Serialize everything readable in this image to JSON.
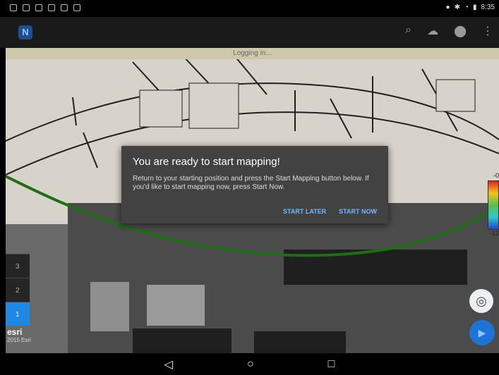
{
  "status_bar": {
    "time": "8:35"
  },
  "app_bar": {
    "logo_label": "N",
    "actions": [
      {
        "name": "search-icon"
      },
      {
        "name": "cloud-upload-icon"
      },
      {
        "name": "location-pin-icon"
      },
      {
        "name": "more-vert-icon"
      }
    ]
  },
  "map": {
    "status_text": "Logging in...",
    "layer_tabs": [
      "3",
      "2",
      "1"
    ],
    "attribution": {
      "brand": "esri",
      "copyright": "2015 Esri"
    },
    "legend": {
      "top_label": "-0",
      "bottom_label": "-12"
    }
  },
  "dialog": {
    "title": "You are ready to start mapping!",
    "body": "Return to your starting position and press the Start Mapping button below. If you'd like to start mapping now, press Start Now.",
    "actions": [
      "START LATER",
      "START NOW"
    ]
  },
  "nav_bar": {
    "back": "◁",
    "home": "○",
    "recents": "□"
  }
}
